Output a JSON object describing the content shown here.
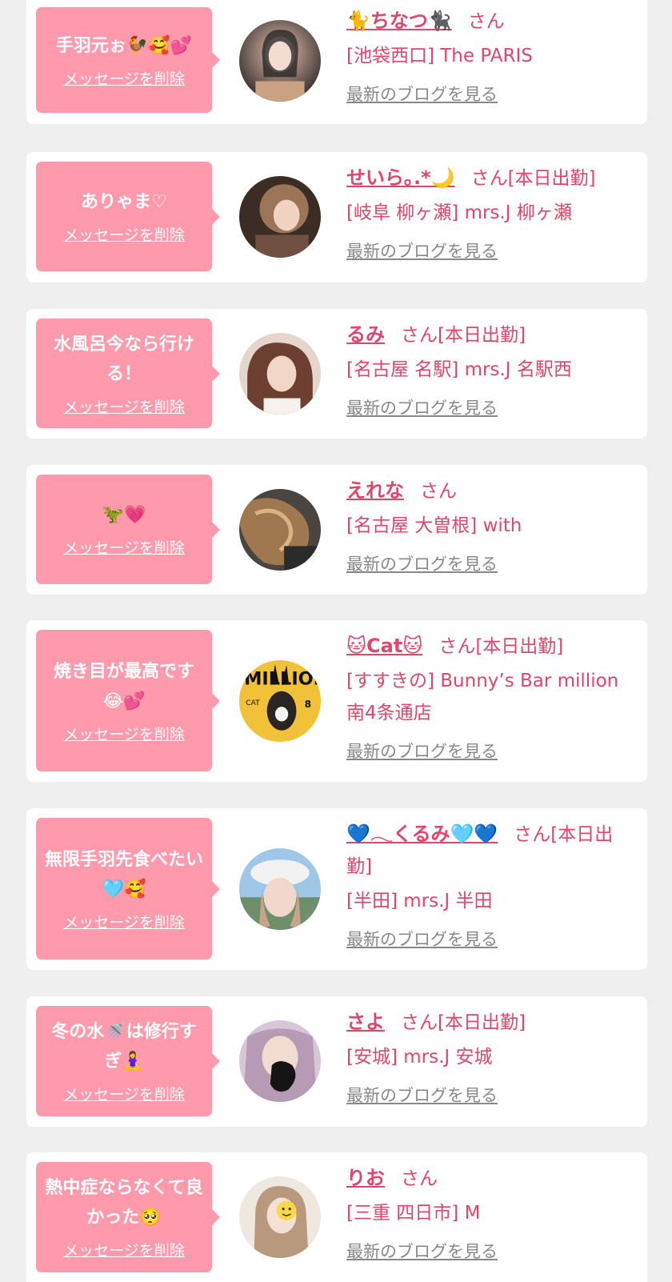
{
  "common": {
    "delete_label": "メッセージを削除",
    "blog_label": "最新のブログを見る",
    "san": "さん",
    "work_today": "[本日出勤]"
  },
  "colors": {
    "bubble": "#fe9aac",
    "accent": "#e0466b",
    "link_gray": "#888888",
    "background": "#efefef"
  },
  "cards": [
    {
      "message": "手羽元ぉ🐓🥰💕",
      "name": "🐈ちなつ🐈‍⬛",
      "suffix": "さん",
      "shop": "[池袋西口] The PARIS"
    },
    {
      "message": "ありゃま♡",
      "name": "せいら｡.*🌙",
      "suffix": "さん[本日出勤]",
      "shop": "[岐阜 柳ヶ瀬] mrs.J 柳ヶ瀬"
    },
    {
      "message": "水風呂今なら行ける！",
      "name": "るみ",
      "suffix": "さん[本日出勤]",
      "shop": "[名古屋 名駅] mrs.J 名駅西"
    },
    {
      "message": "🦖💗",
      "name": "えれな",
      "suffix": "さん",
      "shop": "[名古屋 大曽根] with"
    },
    {
      "message": "焼き目が最高です😂💕",
      "name": "🐱Cat🐱",
      "suffix": "さん[本日出勤]",
      "shop": "[すすきの] Bunny’s Bar million 南4条通店"
    },
    {
      "message": "無限手羽先食べたい🩵🥰",
      "name": "💙𓂃くるみ🩵💙",
      "suffix": "さん[本日出勤]",
      "shop": "[半田] mrs.J 半田"
    },
    {
      "message": "冬の水🚿は修行すぎ🧘‍♀️",
      "name": "さよ",
      "suffix": "さん[本日出勤]",
      "shop": "[安城] mrs.J 安城"
    },
    {
      "message": "熱中症ならなくて良かった🥺",
      "name": "りお",
      "suffix": "さん",
      "shop": "[三重 四日市] M"
    }
  ]
}
